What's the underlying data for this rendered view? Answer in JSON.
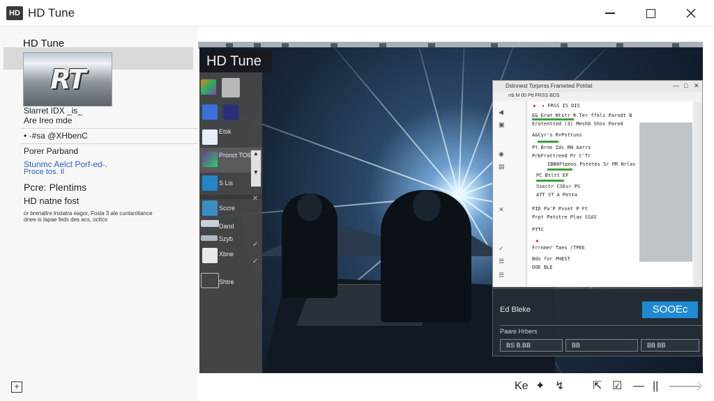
{
  "window": {
    "icon_text": "HD",
    "title": "HD Tune"
  },
  "sidebar": {
    "heading": "HD Tune",
    "logo_text": "RT",
    "lines": [
      "Slarret IDX _is_",
      "Are Ireo mde",
      "• ·#sa @XHbenC",
      "Porer Parband"
    ],
    "blue_line_1": "Stunmc Aelct Porf-ed-.",
    "blue_line_2": "Proce tos. Il",
    "section_title": "Pcre: Plentims",
    "subtitle": "HD natne fost",
    "small_text": "or brenaltre lnstatra eagor, Fosla 3 ale cuntanitiance dnee is lapae fedx des acs, octtcs",
    "bottom_icon": "+"
  },
  "scene": {
    "title": "HD Tune"
  },
  "palette": {
    "items": [
      {
        "label": "",
        "color": "#c0392b"
      },
      {
        "label": "",
        "color": "#3b6fd9"
      },
      {
        "label": "Etsk",
        "color": "#2d6fbe"
      },
      {
        "label": "Pronct TOID",
        "color": "#6b3c8e"
      },
      {
        "label": "S Lis",
        "color": "#2386c9"
      },
      {
        "label": "Sccre",
        "color": "#3b8ec2"
      },
      {
        "label": "Dand",
        "color": "#3a4a5a"
      },
      {
        "label": "Szyb",
        "color": "#5d6b78"
      },
      {
        "label": "Xbne",
        "color": "#6e6e6e"
      },
      {
        "label": "Shtre",
        "color": "#3c3c3c"
      }
    ]
  },
  "inner_window": {
    "title": "Dstnnest Torprrss Frameted Potrlat",
    "menu": "rrb  M 00 Ptt  FRSS  BDS",
    "lines": [
      "✦  FRSS  IS DIS",
      "E& Erat Ntstr   R.Ter ffkls Parndt B",
      "Erotentted (3)   Meshb Shos Pared",
      "A&Cyr's  R+Psttuns",
      "Pt Brne  Idc  RN  Aarrs",
      "PrbFrattreed  Pr  C'Tr",
      "IBB8Ftpeos  Pstetes   Sr PR Nrlas",
      "PC Btltt EF",
      "Ssectr   CSEsr  PS",
      "ATT  ST    A  Petta",
      "PID Pa'P Pvset  P  Ft",
      "Prpt Patstre Plas SSAS",
      "PTTC",
      "Frrnmer Taes (TPEE",
      "Bds for  PHEST",
      "DOE  BLE"
    ]
  },
  "dark_panel": {
    "label": "Ed Bleke",
    "button": "SOOEc",
    "subheading": "Paare Hrbers",
    "fields": [
      "BS B.BB",
      "BB",
      "BB BB"
    ]
  },
  "bottom_toolbar": {
    "icons": [
      "Ke",
      "✦",
      "↯",
      "⇱",
      "☑",
      "—",
      "||"
    ]
  }
}
